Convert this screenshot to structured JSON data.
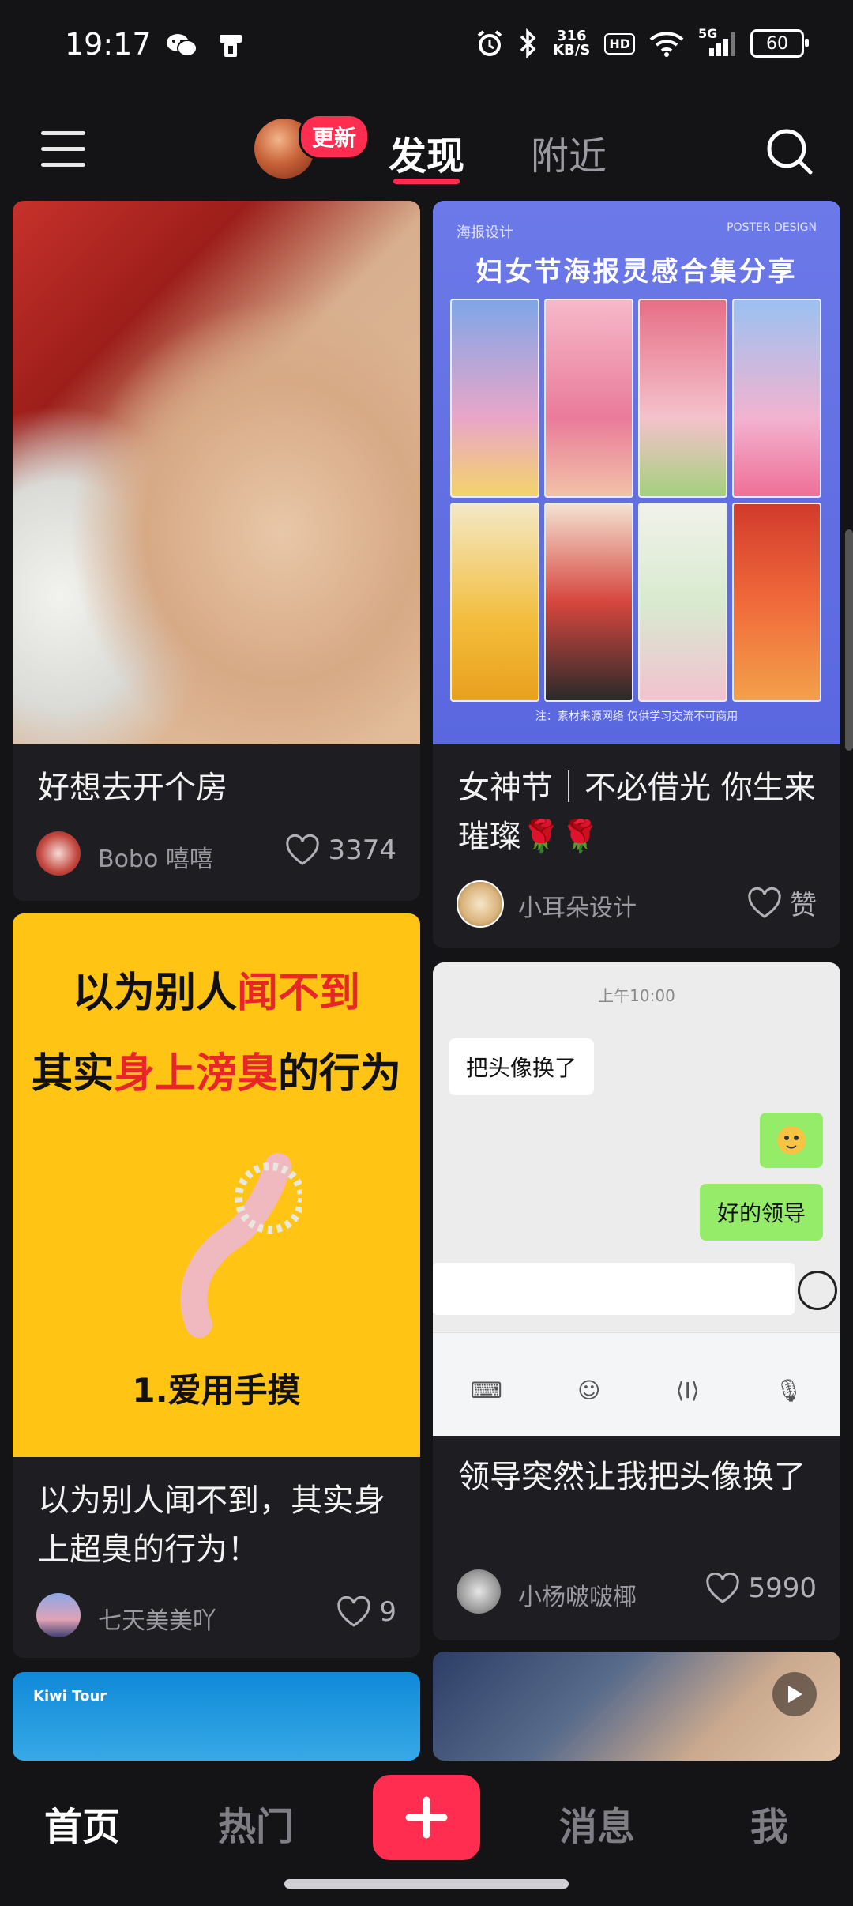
{
  "status": {
    "time": "19:17",
    "speed_value": "316",
    "speed_unit": "KB/S",
    "hd": "HD",
    "network": "5G",
    "battery": "60"
  },
  "topnav": {
    "update_badge": "更新",
    "tab_discover": "发现",
    "tab_nearby": "附近"
  },
  "cards": {
    "c1": {
      "title": "好想去开个房",
      "author": "Bobo 嘻嘻",
      "likes": "3374"
    },
    "c2": {
      "title": "女神节｜不必借光 你生来璀璨🌹🌹",
      "author": "小耳朵设计",
      "likes": "赞",
      "poster_tag": "海报设计",
      "poster_tag_right": "POSTER DESIGN",
      "poster_title": "妇女节海报灵感合集分享",
      "poster_foot": "注：素材来源网络 仅供学习交流不可商用"
    },
    "c3": {
      "title": "以为别人闻不到，其实身上超臭的行为！",
      "author": "七天美美吖",
      "likes": "9",
      "line1_a": "以为别人",
      "line1_b": "闻不到",
      "line2_a": "其实",
      "line2_b": "身上滂臭",
      "line2_c": "的行为",
      "caption": "1.爱用手摸"
    },
    "c4": {
      "title": "领导突然让我把头像换了",
      "author": "小杨啵啵椰",
      "likes": "5990",
      "chat_time": "上午10:00",
      "bubble1": "把头像换了",
      "bubble2": "好的领导"
    },
    "c5": {
      "brand": "Kiwi Tour"
    }
  },
  "bottombar": {
    "home": "首页",
    "hot": "热门",
    "messages": "消息",
    "me": "我"
  }
}
